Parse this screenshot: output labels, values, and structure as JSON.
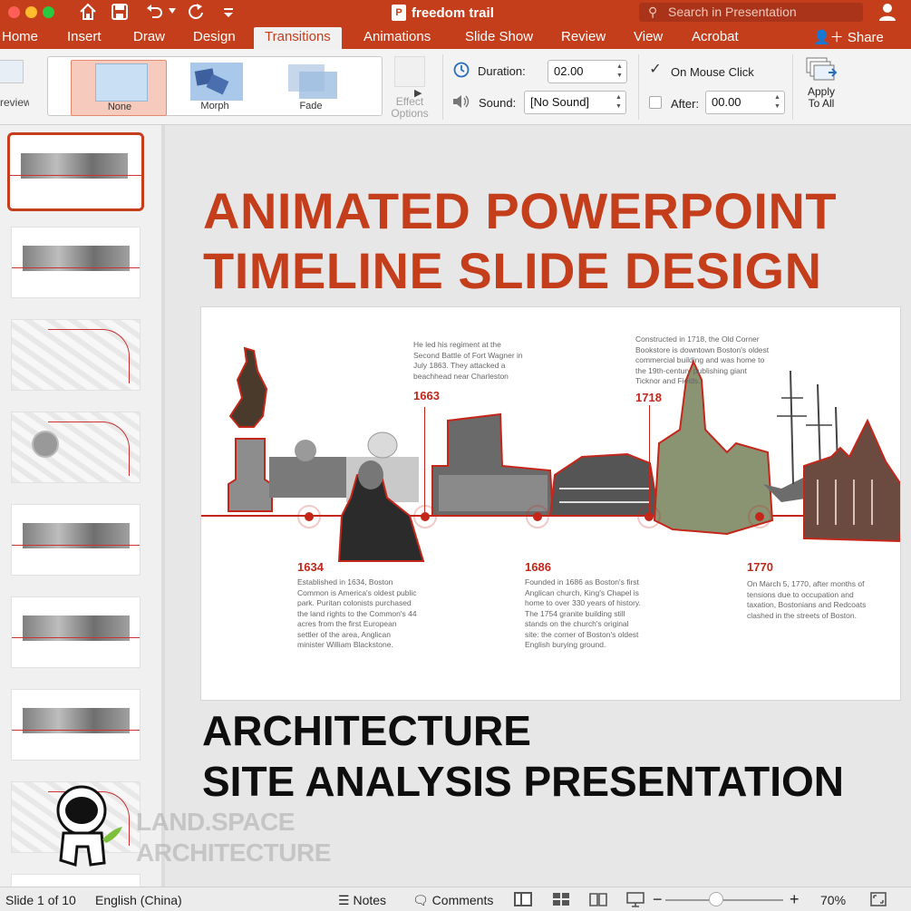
{
  "window": {
    "title": "freedom trail",
    "search_placeholder": "Search in Presentation"
  },
  "ribbon_tabs": [
    {
      "label": "Home"
    },
    {
      "label": "Insert"
    },
    {
      "label": "Draw"
    },
    {
      "label": "Design"
    },
    {
      "label": "Transitions"
    },
    {
      "label": "Animations"
    },
    {
      "label": "Slide Show"
    },
    {
      "label": "Review"
    },
    {
      "label": "View"
    },
    {
      "label": "Acrobat"
    }
  ],
  "active_tab": "Transitions",
  "share_label": "Share",
  "ribbon": {
    "preview_label": "Preview",
    "transitions": [
      {
        "label": "None",
        "selected": true
      },
      {
        "label": "Morph",
        "selected": false
      },
      {
        "label": "Fade",
        "selected": false
      }
    ],
    "effect_options_line1": "Effect",
    "effect_options_line2": "Options",
    "duration_label": "Duration:",
    "duration_value": "02.00",
    "sound_label": "Sound:",
    "sound_value": "[No Sound]",
    "on_mouse_click_label": "On Mouse Click",
    "on_mouse_click_checked": true,
    "after_label": "After:",
    "after_value": "00.00",
    "after_checked": false,
    "apply_line1": "Apply",
    "apply_line2": "To All"
  },
  "slide_panel": {
    "selected_index": 0,
    "thumb_types": [
      "timeline",
      "timeline",
      "map",
      "seal-map",
      "timeline",
      "timeline",
      "timeline",
      "map",
      "timeline"
    ]
  },
  "main": {
    "title_line1": "ANIMATED POWERPOINT",
    "title_line2": "TIMELINE SLIDE DESIGN",
    "subtitle_line1": "ARCHITECTURE",
    "subtitle_line2": "SITE ANALYSIS PRESENTATION"
  },
  "slide": {
    "events": [
      {
        "year": "1634",
        "text": "Established in 1634, Boston Common is America's oldest public park. Puritan colonists purchased the land rights to the Common's 44 acres from the first European settler of the area, Anglican minister William Blackstone."
      },
      {
        "year": "1663",
        "text": "He led his regiment at the Second Battle of Fort Wagner in July 1863. They attacked a beachhead near Charleston"
      },
      {
        "year": "1686",
        "text": "Founded in 1686 as Boston's first Anglican church, King's Chapel is home to over 330 years of history. The 1754 granite building still stands on the church's original site: the corner of Boston's oldest English burying ground."
      },
      {
        "year": "1718",
        "text": "Constructed in 1718, the Old Corner Bookstore is downtown Boston's oldest commercial building and was home to the 19th-century publishing giant Ticknor and Fields."
      },
      {
        "year": "1770",
        "text": "On March 5, 1770, after months of tensions due to occupation and taxation, Bostonians and Redcoats clashed in the streets of Boston."
      }
    ]
  },
  "watermark": {
    "line1": "LAND.SPACE",
    "line2": "ARCHITECTURE"
  },
  "status": {
    "slide_info": "Slide 1 of 10",
    "language": "English (China)",
    "notes_label": "Notes",
    "comments_label": "Comments",
    "zoom": "70%"
  },
  "colors": {
    "accent": "#c43e1c",
    "timeline_red": "#c4261a"
  }
}
